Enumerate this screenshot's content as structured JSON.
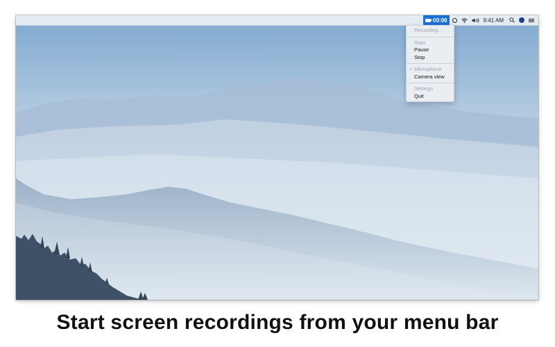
{
  "menubar": {
    "recording_time": "00:06",
    "clock": "9:41 AM",
    "icons": [
      "camera-icon",
      "clock-icon",
      "wifi-icon",
      "volume-icon",
      "search-icon",
      "user-avatar-icon",
      "notification-list-icon"
    ]
  },
  "menu": {
    "recording_label": "Recording...",
    "start_label": "Start",
    "pause_label": "Pause",
    "stop_label": "Stop",
    "microphone_label": "Microphone",
    "microphone_checked": true,
    "checkmark": "✓",
    "camera_view_label": "Camera view",
    "settings_label": "Settings",
    "quit_label": "Quit"
  },
  "caption": "Start screen recordings from your menu bar",
  "colors": {
    "accent": "#1d6fd8",
    "sky_top": "#7ea6ce",
    "sky_bottom": "#e3ecf3",
    "mountain_far": "#8fa9c9",
    "mountain_near": "#6f8cab"
  }
}
